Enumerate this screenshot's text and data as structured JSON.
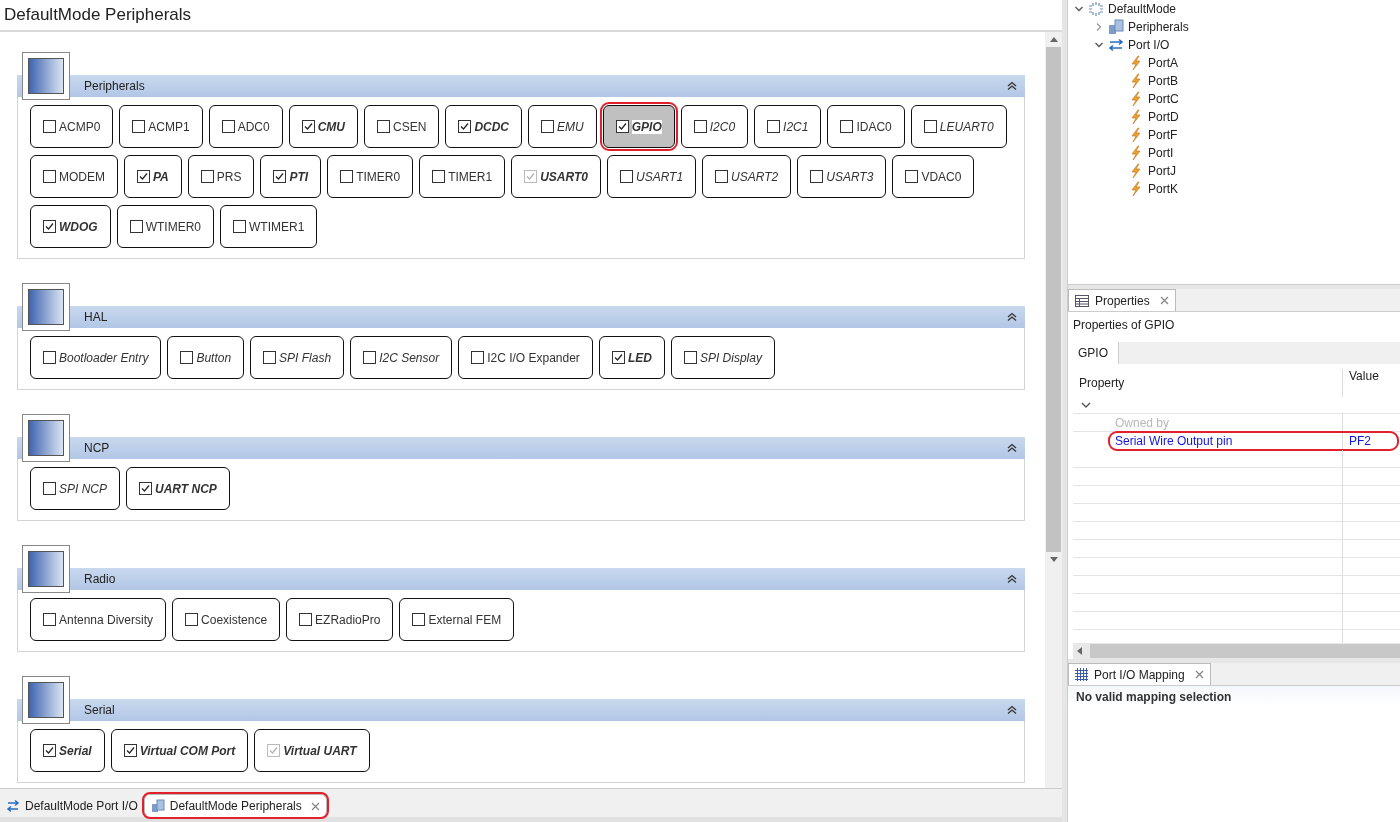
{
  "editor": {
    "title": "DefaultMode Peripherals",
    "sections": [
      {
        "title": "Peripherals",
        "expanded": true,
        "items": [
          {
            "label": "ACMP0",
            "checked": false,
            "disabled": false,
            "italic": false,
            "selected": false,
            "highlighted": false
          },
          {
            "label": "ACMP1",
            "checked": false,
            "disabled": false,
            "italic": false,
            "selected": false,
            "highlighted": false
          },
          {
            "label": "ADC0",
            "checked": false,
            "disabled": false,
            "italic": false,
            "selected": false,
            "highlighted": false
          },
          {
            "label": "CMU",
            "checked": true,
            "disabled": false,
            "italic": true,
            "selected": false,
            "highlighted": false
          },
          {
            "label": "CSEN",
            "checked": false,
            "disabled": false,
            "italic": false,
            "selected": false,
            "highlighted": false
          },
          {
            "label": "DCDC",
            "checked": true,
            "disabled": false,
            "italic": true,
            "selected": false,
            "highlighted": false
          },
          {
            "label": "EMU",
            "checked": false,
            "disabled": false,
            "italic": true,
            "selected": false,
            "highlighted": false
          },
          {
            "label": "GPIO",
            "checked": true,
            "disabled": false,
            "italic": true,
            "selected": true,
            "highlighted": true
          },
          {
            "label": "I2C0",
            "checked": false,
            "disabled": false,
            "italic": true,
            "selected": false,
            "highlighted": false
          },
          {
            "label": "I2C1",
            "checked": false,
            "disabled": false,
            "italic": true,
            "selected": false,
            "highlighted": false
          },
          {
            "label": "IDAC0",
            "checked": false,
            "disabled": false,
            "italic": false,
            "selected": false,
            "highlighted": false
          },
          {
            "label": "LEUART0",
            "checked": false,
            "disabled": false,
            "italic": true,
            "selected": false,
            "highlighted": false
          },
          {
            "label": "MODEM",
            "checked": false,
            "disabled": false,
            "italic": false,
            "selected": false,
            "highlighted": false
          },
          {
            "label": "PA",
            "checked": true,
            "disabled": false,
            "italic": true,
            "selected": false,
            "highlighted": false
          },
          {
            "label": "PRS",
            "checked": false,
            "disabled": false,
            "italic": false,
            "selected": false,
            "highlighted": false
          },
          {
            "label": "PTI",
            "checked": true,
            "disabled": false,
            "italic": true,
            "selected": false,
            "highlighted": false
          },
          {
            "label": "TIMER0",
            "checked": false,
            "disabled": false,
            "italic": false,
            "selected": false,
            "highlighted": false
          },
          {
            "label": "TIMER1",
            "checked": false,
            "disabled": false,
            "italic": false,
            "selected": false,
            "highlighted": false
          },
          {
            "label": "USART0",
            "checked": true,
            "disabled": true,
            "italic": true,
            "selected": false,
            "highlighted": false
          },
          {
            "label": "USART1",
            "checked": false,
            "disabled": false,
            "italic": true,
            "selected": false,
            "highlighted": false
          },
          {
            "label": "USART2",
            "checked": false,
            "disabled": false,
            "italic": true,
            "selected": false,
            "highlighted": false
          },
          {
            "label": "USART3",
            "checked": false,
            "disabled": false,
            "italic": true,
            "selected": false,
            "highlighted": false
          },
          {
            "label": "VDAC0",
            "checked": false,
            "disabled": false,
            "italic": false,
            "selected": false,
            "highlighted": false
          },
          {
            "label": "WDOG",
            "checked": true,
            "disabled": false,
            "italic": true,
            "selected": false,
            "highlighted": false
          },
          {
            "label": "WTIMER0",
            "checked": false,
            "disabled": false,
            "italic": false,
            "selected": false,
            "highlighted": false
          },
          {
            "label": "WTIMER1",
            "checked": false,
            "disabled": false,
            "italic": false,
            "selected": false,
            "highlighted": false
          }
        ]
      },
      {
        "title": "HAL",
        "expanded": true,
        "items": [
          {
            "label": "Bootloader Entry",
            "checked": false,
            "disabled": false,
            "italic": true,
            "selected": false,
            "highlighted": false
          },
          {
            "label": "Button",
            "checked": false,
            "disabled": false,
            "italic": true,
            "selected": false,
            "highlighted": false
          },
          {
            "label": "SPI Flash",
            "checked": false,
            "disabled": false,
            "italic": true,
            "selected": false,
            "highlighted": false
          },
          {
            "label": "I2C Sensor",
            "checked": false,
            "disabled": false,
            "italic": true,
            "selected": false,
            "highlighted": false
          },
          {
            "label": "I2C I/O Expander",
            "checked": false,
            "disabled": false,
            "italic": false,
            "selected": false,
            "highlighted": false
          },
          {
            "label": "LED",
            "checked": true,
            "disabled": false,
            "italic": true,
            "selected": false,
            "highlighted": false
          },
          {
            "label": "SPI Display",
            "checked": false,
            "disabled": false,
            "italic": true,
            "selected": false,
            "highlighted": false
          }
        ]
      },
      {
        "title": "NCP",
        "expanded": true,
        "items": [
          {
            "label": "SPI NCP",
            "checked": false,
            "disabled": false,
            "italic": true,
            "selected": false,
            "highlighted": false
          },
          {
            "label": "UART NCP",
            "checked": true,
            "disabled": false,
            "italic": true,
            "selected": false,
            "highlighted": false
          }
        ]
      },
      {
        "title": "Radio",
        "expanded": true,
        "items": [
          {
            "label": "Antenna Diversity",
            "checked": false,
            "disabled": false,
            "italic": false,
            "selected": false,
            "highlighted": false
          },
          {
            "label": "Coexistence",
            "checked": false,
            "disabled": false,
            "italic": false,
            "selected": false,
            "highlighted": false
          },
          {
            "label": "EZRadioPro",
            "checked": false,
            "disabled": false,
            "italic": false,
            "selected": false,
            "highlighted": false
          },
          {
            "label": "External FEM",
            "checked": false,
            "disabled": false,
            "italic": false,
            "selected": false,
            "highlighted": false
          }
        ]
      },
      {
        "title": "Serial",
        "expanded": true,
        "items": [
          {
            "label": "Serial",
            "checked": true,
            "disabled": false,
            "italic": true,
            "selected": false,
            "highlighted": false
          },
          {
            "label": "Virtual COM Port",
            "checked": true,
            "disabled": false,
            "italic": true,
            "selected": false,
            "highlighted": false
          },
          {
            "label": "Virtual UART",
            "checked": true,
            "disabled": true,
            "italic": true,
            "selected": false,
            "highlighted": false
          }
        ]
      }
    ]
  },
  "editor_tabs": [
    {
      "label": "DefaultMode Port I/O",
      "kind": "portio",
      "selected": false,
      "closable": false,
      "highlighted": false
    },
    {
      "label": "DefaultMode Peripherals",
      "kind": "peripherals",
      "selected": true,
      "closable": true,
      "highlighted": true
    }
  ],
  "outline": {
    "tree": [
      {
        "label": "DefaultMode",
        "kind": "mode",
        "expanded": true,
        "children": [
          {
            "label": "Peripherals",
            "kind": "peripherals",
            "expanded": false
          },
          {
            "label": "Port I/O",
            "kind": "portio",
            "expanded": true,
            "children": [
              {
                "label": "PortA",
                "kind": "port"
              },
              {
                "label": "PortB",
                "kind": "port"
              },
              {
                "label": "PortC",
                "kind": "port"
              },
              {
                "label": "PortD",
                "kind": "port"
              },
              {
                "label": "PortF",
                "kind": "port"
              },
              {
                "label": "PortI",
                "kind": "port"
              },
              {
                "label": "PortJ",
                "kind": "port"
              },
              {
                "label": "PortK",
                "kind": "port"
              }
            ]
          }
        ]
      }
    ]
  },
  "properties": {
    "tab": "Properties",
    "heading": "Properties of GPIO",
    "subtab": "GPIO",
    "columns": [
      "Property",
      "Value"
    ],
    "group": {
      "expanded": true
    },
    "rows": [
      {
        "property": "Owned by",
        "disabled": true,
        "highlighted": false
      },
      {
        "property": "Serial Wire Output pin",
        "value": "PF2",
        "disabled": false,
        "highlighted": true
      }
    ]
  },
  "mapping": {
    "tab": "Port I/O Mapping",
    "message": "No valid mapping selection"
  }
}
